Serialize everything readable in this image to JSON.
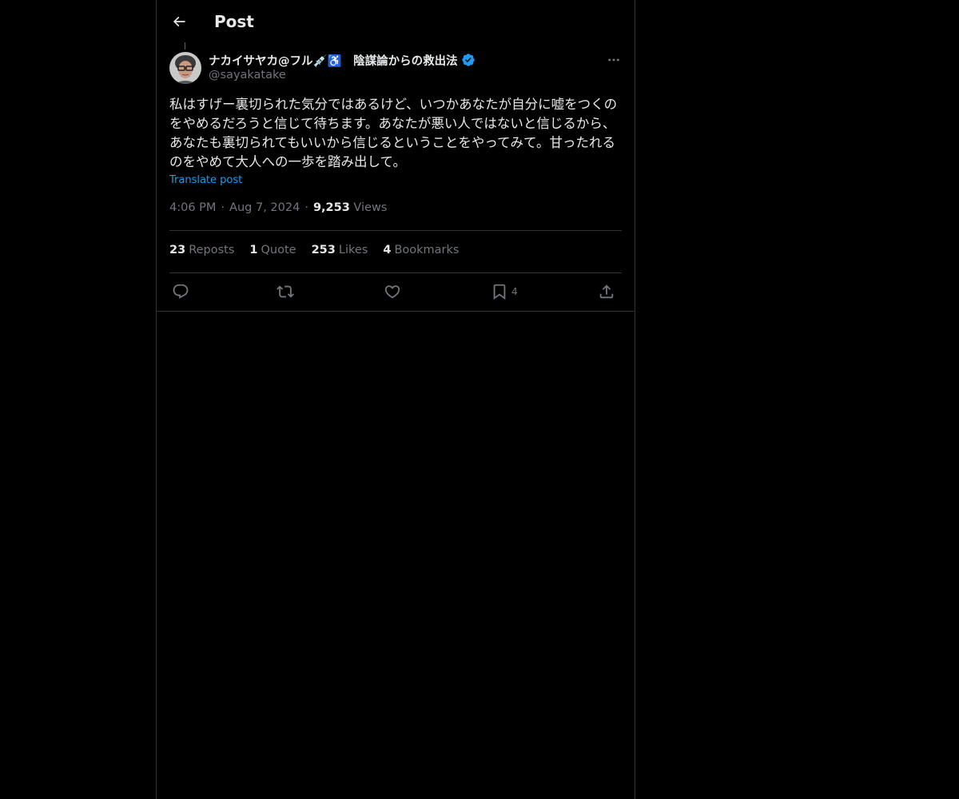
{
  "header": {
    "title": "Post",
    "back_icon": "arrow-left-icon"
  },
  "author": {
    "display_name": "ナカイサヤカ@フル💉♿️　陰謀論からの救出法",
    "handle": "@sayakatake",
    "verified_icon": "verified-badge-icon",
    "verified_color": "#1d9bf0"
  },
  "post": {
    "text": "私はすげー裏切られた気分ではあるけど、いつかあなたが自分に嘘をつくのをやめるだろうと信じて待ちます。あなたが悪い人ではないと信じるから、あなたも裏切られてもいいから信じるということをやってみて。甘ったれるのをやめて大人への一歩を踏み出して。",
    "translate_label": "Translate post",
    "time": "4:06 PM",
    "date": "Aug 7, 2024",
    "views_count": "9,253",
    "views_label": "Views"
  },
  "stats": {
    "reposts_count": "23",
    "reposts_label": "Reposts",
    "quotes_count": "1",
    "quotes_label": "Quote",
    "likes_count": "253",
    "likes_label": "Likes",
    "bookmarks_count": "4",
    "bookmarks_label": "Bookmarks"
  },
  "actions": {
    "reply_icon": "reply-icon",
    "repost_icon": "repost-icon",
    "like_icon": "heart-icon",
    "bookmark_icon": "bookmark-icon",
    "bookmark_count": "4",
    "share_icon": "share-icon"
  },
  "colors": {
    "background": "#000000",
    "text": "#e7e9ea",
    "secondary": "#71767b",
    "accent": "#1d9bf0",
    "border": "#2f3336"
  }
}
